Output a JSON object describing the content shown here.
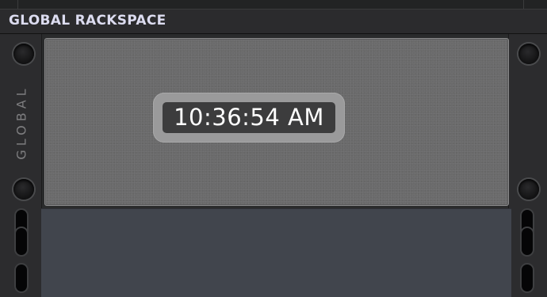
{
  "header": {
    "title": "GLOBAL RACKSPACE"
  },
  "global_panel": {
    "side_label": "GLOBAL",
    "clock": {
      "time": "10:36:54 AM"
    }
  },
  "colors": {
    "header_text": "#dcdcf0",
    "panel_background": "#6a6a6b",
    "clock_background": "#3c3c3d",
    "empty_rack_area": "#41454d"
  }
}
